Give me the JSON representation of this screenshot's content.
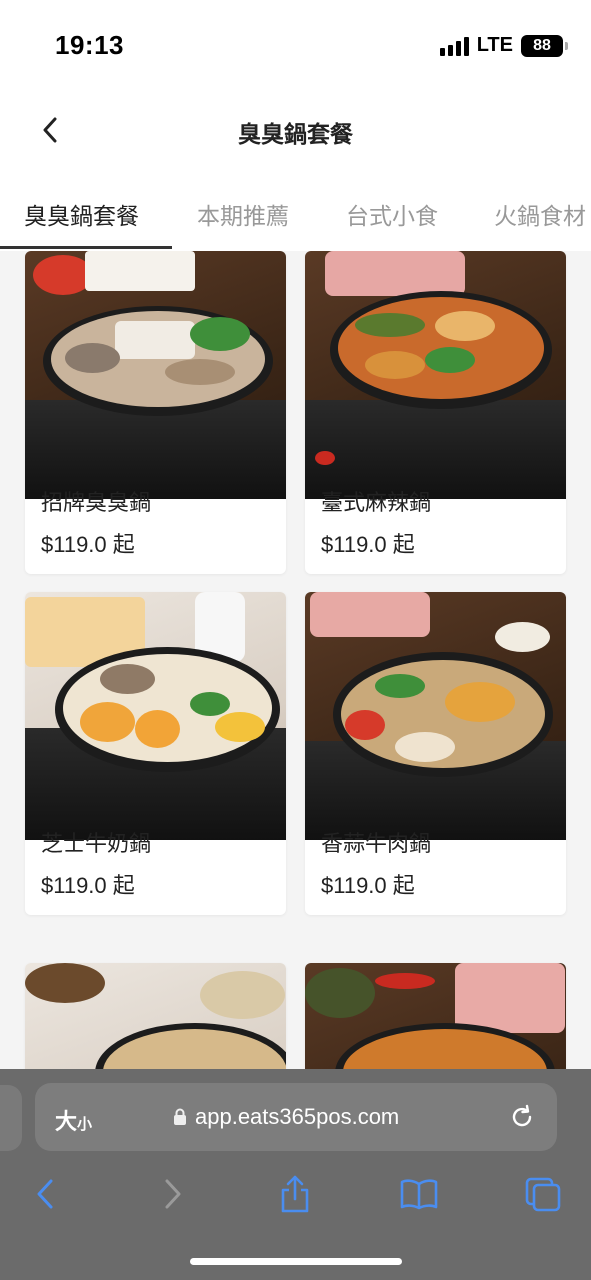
{
  "status": {
    "time": "19:13",
    "network": "LTE",
    "battery": "88"
  },
  "header": {
    "title": "臭臭鍋套餐"
  },
  "tabs": [
    {
      "label": "臭臭鍋套餐",
      "active": true
    },
    {
      "label": "本期推薦",
      "active": false
    },
    {
      "label": "台式小食",
      "active": false
    },
    {
      "label": "火鍋食材",
      "active": false
    }
  ],
  "products": [
    {
      "name": "招牌臭臭鍋",
      "price": "$119.0 起"
    },
    {
      "name": "臺式麻辣鍋",
      "price": "$119.0 起"
    },
    {
      "name": "芝士牛奶鍋",
      "price": "$119.0 起"
    },
    {
      "name": "香蒜牛肉鍋",
      "price": "$119.0 起"
    },
    {
      "name": "",
      "price": ""
    },
    {
      "name": "",
      "price": ""
    }
  ],
  "browser": {
    "text_size_label": "大",
    "text_size_small": "小",
    "url": "app.eats365pos.com"
  },
  "icons": {
    "back": "chevron-left-icon",
    "lock": "lock-icon",
    "reload": "reload-icon",
    "browser_back": "browser-back-icon",
    "browser_forward": "browser-forward-icon",
    "share": "share-icon",
    "bookmarks": "bookmarks-icon",
    "tabs": "tabs-icon"
  },
  "colors": {
    "accent": "#2f80ed",
    "tab_active": "#222222",
    "tab_inactive": "#999999",
    "browser_bar": "#6b6b6b"
  }
}
